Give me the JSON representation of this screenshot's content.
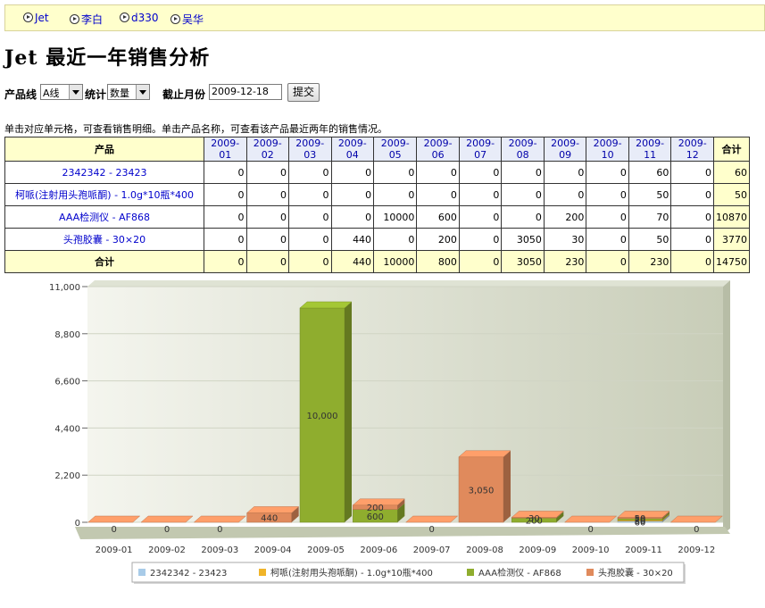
{
  "nav": {
    "items": [
      "Jet",
      "李白",
      "d330",
      "吴华"
    ]
  },
  "page": {
    "title": "Jet  最近一年销售分析"
  },
  "form": {
    "product_line_label": "产品线",
    "product_line_value": "A线",
    "stat_label": "统计",
    "stat_value": "数量",
    "date_label": "截止月份",
    "date_value": "2009-12-18",
    "submit_label": "提交"
  },
  "note": "单击对应单元格，可查看销售明细。单击产品名称，可查看该产品最近两年的销售情况。",
  "table": {
    "product_header": "产品",
    "months": [
      "2009-01",
      "2009-02",
      "2009-03",
      "2009-04",
      "2009-05",
      "2009-06",
      "2009-07",
      "2009-08",
      "2009-09",
      "2009-10",
      "2009-11",
      "2009-12"
    ],
    "total_header": "合计",
    "rows": [
      {
        "name": "2342342 - 23423",
        "values": [
          "0",
          "0",
          "0",
          "0",
          "0",
          "0",
          "0",
          "0",
          "0",
          "0",
          "60",
          "0"
        ],
        "total": "60"
      },
      {
        "name": "柯哌(注射用头孢哌酮) - 1.0g*10瓶*400",
        "values": [
          "0",
          "0",
          "0",
          "0",
          "0",
          "0",
          "0",
          "0",
          "0",
          "0",
          "50",
          "0"
        ],
        "total": "50"
      },
      {
        "name": "AAA检测仪 - AF868",
        "values": [
          "0",
          "0",
          "0",
          "0",
          "10000",
          "600",
          "0",
          "0",
          "200",
          "0",
          "70",
          "0"
        ],
        "total": "10870"
      },
      {
        "name": "头孢胶囊 - 30×20",
        "values": [
          "0",
          "0",
          "0",
          "440",
          "0",
          "200",
          "0",
          "3050",
          "30",
          "0",
          "50",
          "0"
        ],
        "total": "3770"
      }
    ],
    "sum_row": {
      "label": "合计",
      "values": [
        "0",
        "0",
        "0",
        "440",
        "10000",
        "800",
        "0",
        "3050",
        "230",
        "0",
        "230",
        "0"
      ],
      "total": "14750"
    }
  },
  "chart_data": {
    "type": "bar",
    "stacked": true,
    "categories": [
      "2009-01",
      "2009-02",
      "2009-03",
      "2009-04",
      "2009-05",
      "2009-06",
      "2009-07",
      "2009-08",
      "2009-09",
      "2009-10",
      "2009-11",
      "2009-12"
    ],
    "series": [
      {
        "name": "2342342 - 23423",
        "color": "#a8cbe8",
        "values": [
          0,
          0,
          0,
          0,
          0,
          0,
          0,
          0,
          0,
          0,
          60,
          0
        ]
      },
      {
        "name": "柯哌(注射用头孢哌酮) - 1.0g*10瓶*400",
        "color": "#f0b429",
        "values": [
          0,
          0,
          0,
          0,
          0,
          0,
          0,
          0,
          0,
          0,
          50,
          0
        ]
      },
      {
        "name": "AAA检测仪 - AF868",
        "color": "#8fad2e",
        "values": [
          0,
          0,
          0,
          0,
          10000,
          600,
          0,
          0,
          200,
          0,
          70,
          0
        ]
      },
      {
        "name": "头孢胶囊 - 30×20",
        "color": "#e08a5c",
        "values": [
          0,
          0,
          0,
          440,
          0,
          200,
          0,
          3050,
          30,
          0,
          50,
          0
        ]
      }
    ],
    "yticks": [
      "0",
      "2,200",
      "4,400",
      "6,600",
      "8,800",
      "11,000"
    ],
    "ylim": [
      0,
      11000
    ],
    "legend_position": "bottom",
    "grid": true
  }
}
